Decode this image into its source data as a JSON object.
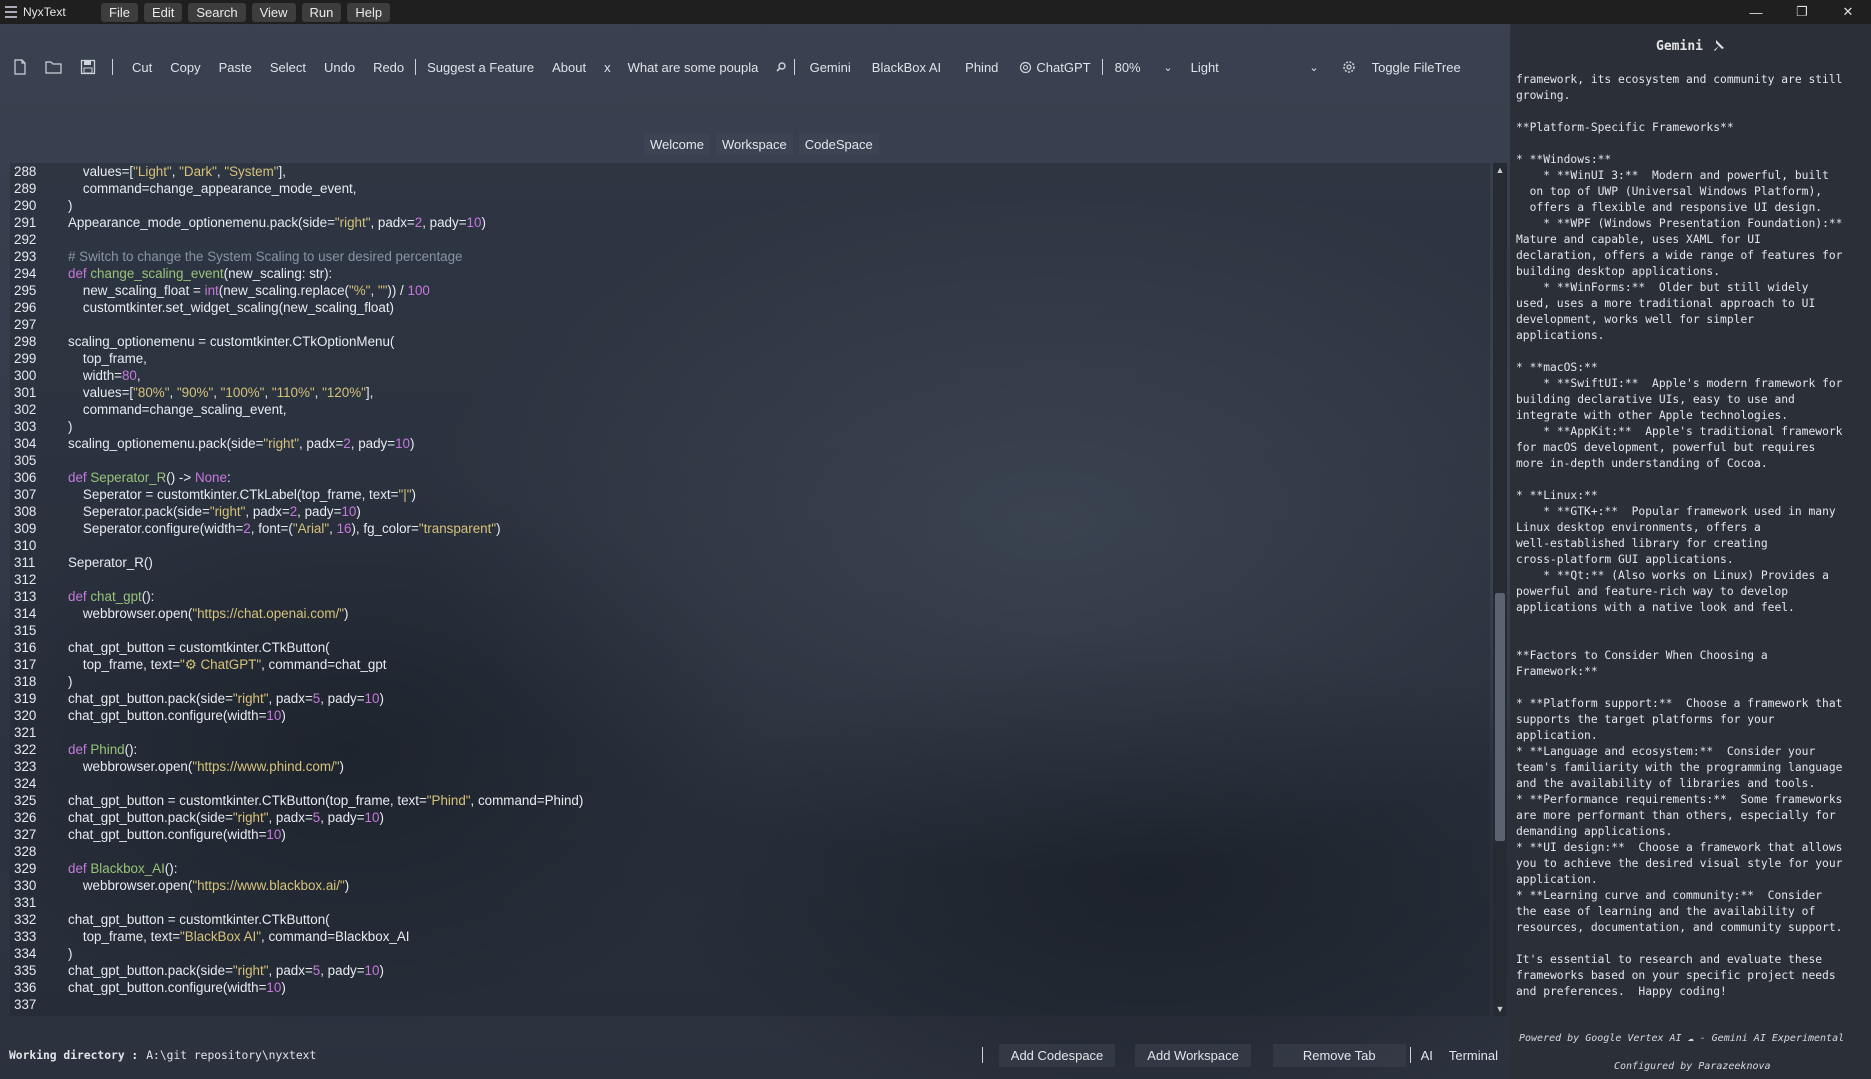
{
  "app": {
    "title": "NyxText"
  },
  "menu": [
    "File",
    "Edit",
    "Search",
    "View",
    "Run",
    "Help"
  ],
  "window_controls": {
    "minimize": "—",
    "restore": "❐",
    "close": "✕"
  },
  "toolbar": {
    "cut": "Cut",
    "copy": "Copy",
    "paste": "Paste",
    "select": "Select",
    "undo": "Undo",
    "redo": "Redo",
    "suggest": "Suggest a Feature",
    "about": "About",
    "close_x": "x",
    "search_value": "What are some poupla",
    "gemini": "Gemini",
    "blackbox": "BlackBox AI",
    "phind": "Phind",
    "chatgpt": "ChatGPT",
    "zoom": "80%",
    "theme": "Light",
    "toggle_filetree": "Toggle FileTree"
  },
  "tabs": [
    "Welcome",
    "Workspace",
    "CodeSpace"
  ],
  "editor": {
    "lines": [
      {
        "n": "288",
        "t": "    values=[\"Light\", \"Dark\", \"System\"],"
      },
      {
        "n": "289",
        "t": "    command=change_appearance_mode_event,"
      },
      {
        "n": "290",
        "t": ")"
      },
      {
        "n": "291",
        "t": "Appearance_mode_optionemenu.pack(side=\"right\", padx=2, pady=10)"
      },
      {
        "n": "292",
        "t": ""
      },
      {
        "n": "293",
        "t": "# Switch to change the System Scaling to user desired percentage"
      },
      {
        "n": "294",
        "t": "def change_scaling_event(new_scaling: str):"
      },
      {
        "n": "295",
        "t": "    new_scaling_float = int(new_scaling.replace(\"%\", \"\")) / 100"
      },
      {
        "n": "296",
        "t": "    customtkinter.set_widget_scaling(new_scaling_float)"
      },
      {
        "n": "297",
        "t": ""
      },
      {
        "n": "298",
        "t": "scaling_optionemenu = customtkinter.CTkOptionMenu("
      },
      {
        "n": "299",
        "t": "    top_frame,"
      },
      {
        "n": "300",
        "t": "    width=80,"
      },
      {
        "n": "301",
        "t": "    values=[\"80%\", \"90%\", \"100%\", \"110%\", \"120%\"],"
      },
      {
        "n": "302",
        "t": "    command=change_scaling_event,"
      },
      {
        "n": "303",
        "t": ")"
      },
      {
        "n": "304",
        "t": "scaling_optionemenu.pack(side=\"right\", padx=2, pady=10)"
      },
      {
        "n": "305",
        "t": ""
      },
      {
        "n": "306",
        "t": "def Seperator_R() -> None:"
      },
      {
        "n": "307",
        "t": "    Seperator = customtkinter.CTkLabel(top_frame, text=\"|\")"
      },
      {
        "n": "308",
        "t": "    Seperator.pack(side=\"right\", padx=2, pady=10)"
      },
      {
        "n": "309",
        "t": "    Seperator.configure(width=2, font=(\"Arial\", 16), fg_color=\"transparent\")"
      },
      {
        "n": "310",
        "t": ""
      },
      {
        "n": "311",
        "t": "Seperator_R()"
      },
      {
        "n": "312",
        "t": ""
      },
      {
        "n": "313",
        "t": "def chat_gpt():"
      },
      {
        "n": "314",
        "t": "    webbrowser.open(\"https://chat.openai.com/\")"
      },
      {
        "n": "315",
        "t": ""
      },
      {
        "n": "316",
        "t": "chat_gpt_button = customtkinter.CTkButton("
      },
      {
        "n": "317",
        "t": "    top_frame, text=\"⚙ ChatGPT\", command=chat_gpt"
      },
      {
        "n": "318",
        "t": ")"
      },
      {
        "n": "319",
        "t": "chat_gpt_button.pack(side=\"right\", padx=5, pady=10)"
      },
      {
        "n": "320",
        "t": "chat_gpt_button.configure(width=10)"
      },
      {
        "n": "321",
        "t": ""
      },
      {
        "n": "322",
        "t": "def Phind():"
      },
      {
        "n": "323",
        "t": "    webbrowser.open(\"https://www.phind.com/\")"
      },
      {
        "n": "324",
        "t": ""
      },
      {
        "n": "325",
        "t": "chat_gpt_button = customtkinter.CTkButton(top_frame, text=\"Phind\", command=Phind)"
      },
      {
        "n": "326",
        "t": "chat_gpt_button.pack(side=\"right\", padx=5, pady=10)"
      },
      {
        "n": "327",
        "t": "chat_gpt_button.configure(width=10)"
      },
      {
        "n": "328",
        "t": ""
      },
      {
        "n": "329",
        "t": "def Blackbox_AI():"
      },
      {
        "n": "330",
        "t": "    webbrowser.open(\"https://www.blackbox.ai/\")"
      },
      {
        "n": "331",
        "t": ""
      },
      {
        "n": "332",
        "t": "chat_gpt_button = customtkinter.CTkButton("
      },
      {
        "n": "333",
        "t": "    top_frame, text=\"BlackBox AI\", command=Blackbox_AI"
      },
      {
        "n": "334",
        "t": ")"
      },
      {
        "n": "335",
        "t": "chat_gpt_button.pack(side=\"right\", padx=5, pady=10)"
      },
      {
        "n": "336",
        "t": "chat_gpt_button.configure(width=10)"
      },
      {
        "n": "337",
        "t": ""
      }
    ]
  },
  "gemini_panel": {
    "title": "Gemini",
    "content": "framework, its ecosystem and community are still\ngrowing.\n\n**Platform-Specific Frameworks**\n\n* **Windows:**\n    * **WinUI 3:**  Modern and powerful, built\n  on top of UWP (Universal Windows Platform),\n  offers a flexible and responsive UI design.\n    * **WPF (Windows Presentation Foundation):**\nMature and capable, uses XAML for UI\ndeclaration, offers a wide range of features for\nbuilding desktop applications.\n    * **WinForms:**  Older but still widely\nused, uses a more traditional approach to UI\ndevelopment, works well for simpler\napplications.\n\n* **macOS:**\n    * **SwiftUI:**  Apple's modern framework for\nbuilding declarative UIs, easy to use and\nintegrate with other Apple technologies.\n    * **AppKit:**  Apple's traditional framework\nfor macOS development, powerful but requires\nmore in-depth understanding of Cocoa.\n\n* **Linux:**\n    * **GTK+:**  Popular framework used in many\nLinux desktop environments, offers a\nwell-established library for creating\ncross-platform GUI applications.\n    * **Qt:** (Also works on Linux) Provides a\npowerful and feature-rich way to develop\napplications with a native look and feel.\n\n\n**Factors to Consider When Choosing a\nFramework:**\n\n* **Platform support:**  Choose a framework that\nsupports the target platforms for your\napplication.\n* **Language and ecosystem:**  Consider your\nteam's familiarity with the programming language\nand the availability of libraries and tools.\n* **Performance requirements:**  Some frameworks\nare more performant than others, especially for\ndemanding applications.\n* **UI design:**  Choose a framework that allows\nyou to achieve the desired visual style for your\napplication.\n* **Learning curve and community:**  Consider\nthe ease of learning and the availability of\nresources, documentation, and community support.\n\nIt's essential to research and evaluate these\nframeworks based on your specific project needs\nand preferences.  Happy coding!",
    "footer_powered": "Powered by Google Vertex AI ☁  - Gemini AI Experimental",
    "footer_configured": "Configured by Parazeeknova"
  },
  "status": {
    "wd_label": "Working directory :",
    "wd_value": "A:\\git repository\\nyxtext",
    "add_codespace": "Add Codespace",
    "add_workspace": "Add Workspace",
    "remove_tab": "Remove Tab",
    "ai": "AI",
    "terminal": "Terminal"
  },
  "colors": {
    "keyword": "#c678dd",
    "function": "#98c379",
    "string": "#d7c27a",
    "number": "#c678dd",
    "comment": "#8a93a6",
    "builtin": "#c678dd"
  }
}
